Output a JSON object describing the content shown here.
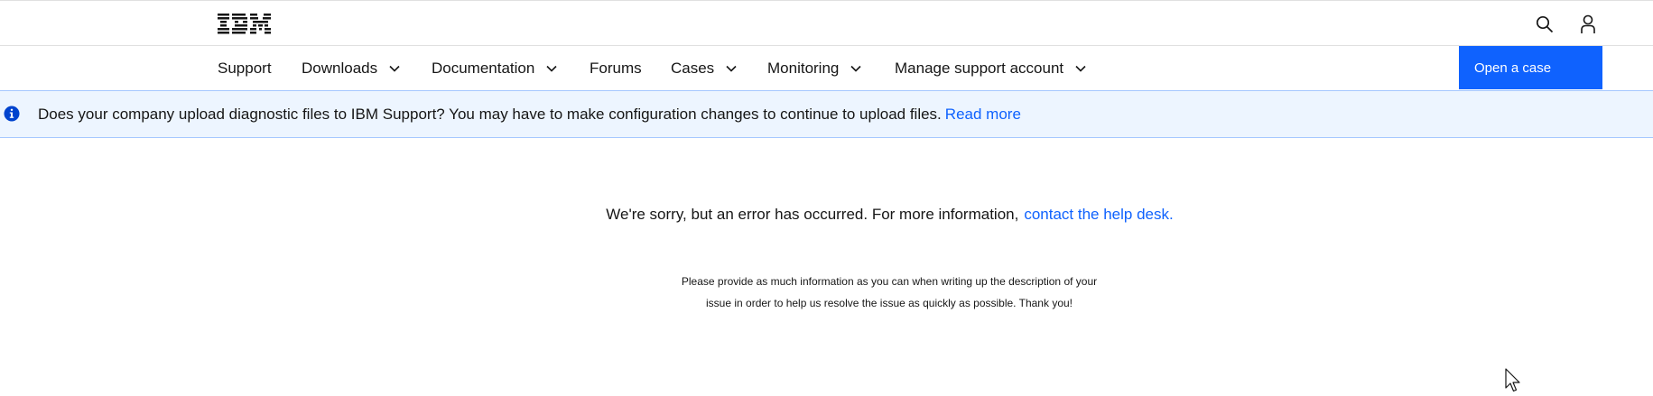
{
  "header": {
    "logo_text": "IBM",
    "search_icon": "search-icon",
    "user_icon": "user-icon"
  },
  "nav": {
    "items": [
      {
        "label": "Support",
        "has_menu": false
      },
      {
        "label": "Downloads",
        "has_menu": true
      },
      {
        "label": "Documentation",
        "has_menu": true
      },
      {
        "label": "Forums",
        "has_menu": false
      },
      {
        "label": "Cases",
        "has_menu": true
      },
      {
        "label": "Monitoring",
        "has_menu": true
      },
      {
        "label": "Manage support account",
        "has_menu": true
      }
    ],
    "cta_label": "Open a case"
  },
  "banner": {
    "icon": "info-icon",
    "message": "Does your company upload diagnostic files to IBM Support? You may have to make configuration changes to continue to upload files.",
    "link_label": "Read more"
  },
  "error": {
    "message": "We're sorry, but an error has occurred. For more information,",
    "link_label": "contact the help desk.",
    "note_line1": "Please provide as much information as you can when writing up the description of your",
    "note_line2": "issue in order to help us resolve the issue as quickly as possible. Thank you!"
  },
  "colors": {
    "accent": "#0f62fe",
    "banner_bg": "#edf5ff",
    "info_icon": "#0043ce"
  }
}
